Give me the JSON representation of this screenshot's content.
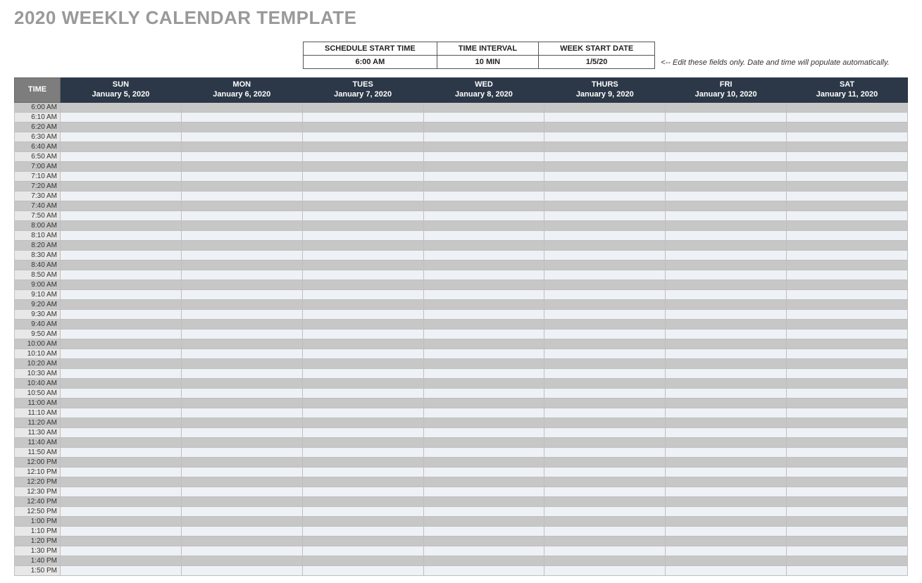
{
  "title": "2020 WEEKLY CALENDAR TEMPLATE",
  "config": {
    "headers": [
      "SCHEDULE START TIME",
      "TIME INTERVAL",
      "WEEK START DATE"
    ],
    "values": [
      "6:00 AM",
      "10 MIN",
      "1/5/20"
    ],
    "note": "<-- Edit these fields only. Date and time will populate automatically."
  },
  "columns": {
    "time": "TIME",
    "days": [
      {
        "label": "SUN",
        "date": "January 5, 2020"
      },
      {
        "label": "MON",
        "date": "January 6, 2020"
      },
      {
        "label": "TUES",
        "date": "January 7, 2020"
      },
      {
        "label": "WED",
        "date": "January 8, 2020"
      },
      {
        "label": "THURS",
        "date": "January 9, 2020"
      },
      {
        "label": "FRI",
        "date": "January 10, 2020"
      },
      {
        "label": "SAT",
        "date": "January 11, 2020"
      }
    ]
  },
  "time_slots": [
    "6:00 AM",
    "6:10 AM",
    "6:20 AM",
    "6:30 AM",
    "6:40 AM",
    "6:50 AM",
    "7:00 AM",
    "7:10 AM",
    "7:20 AM",
    "7:30 AM",
    "7:40 AM",
    "7:50 AM",
    "8:00 AM",
    "8:10 AM",
    "8:20 AM",
    "8:30 AM",
    "8:40 AM",
    "8:50 AM",
    "9:00 AM",
    "9:10 AM",
    "9:20 AM",
    "9:30 AM",
    "9:40 AM",
    "9:50 AM",
    "10:00 AM",
    "10:10 AM",
    "10:20 AM",
    "10:30 AM",
    "10:40 AM",
    "10:50 AM",
    "11:00 AM",
    "11:10 AM",
    "11:20 AM",
    "11:30 AM",
    "11:40 AM",
    "11:50 AM",
    "12:00 PM",
    "12:10 PM",
    "12:20 PM",
    "12:30 PM",
    "12:40 PM",
    "12:50 PM",
    "1:00 PM",
    "1:10 PM",
    "1:20 PM",
    "1:30 PM",
    "1:40 PM",
    "1:50 PM"
  ]
}
